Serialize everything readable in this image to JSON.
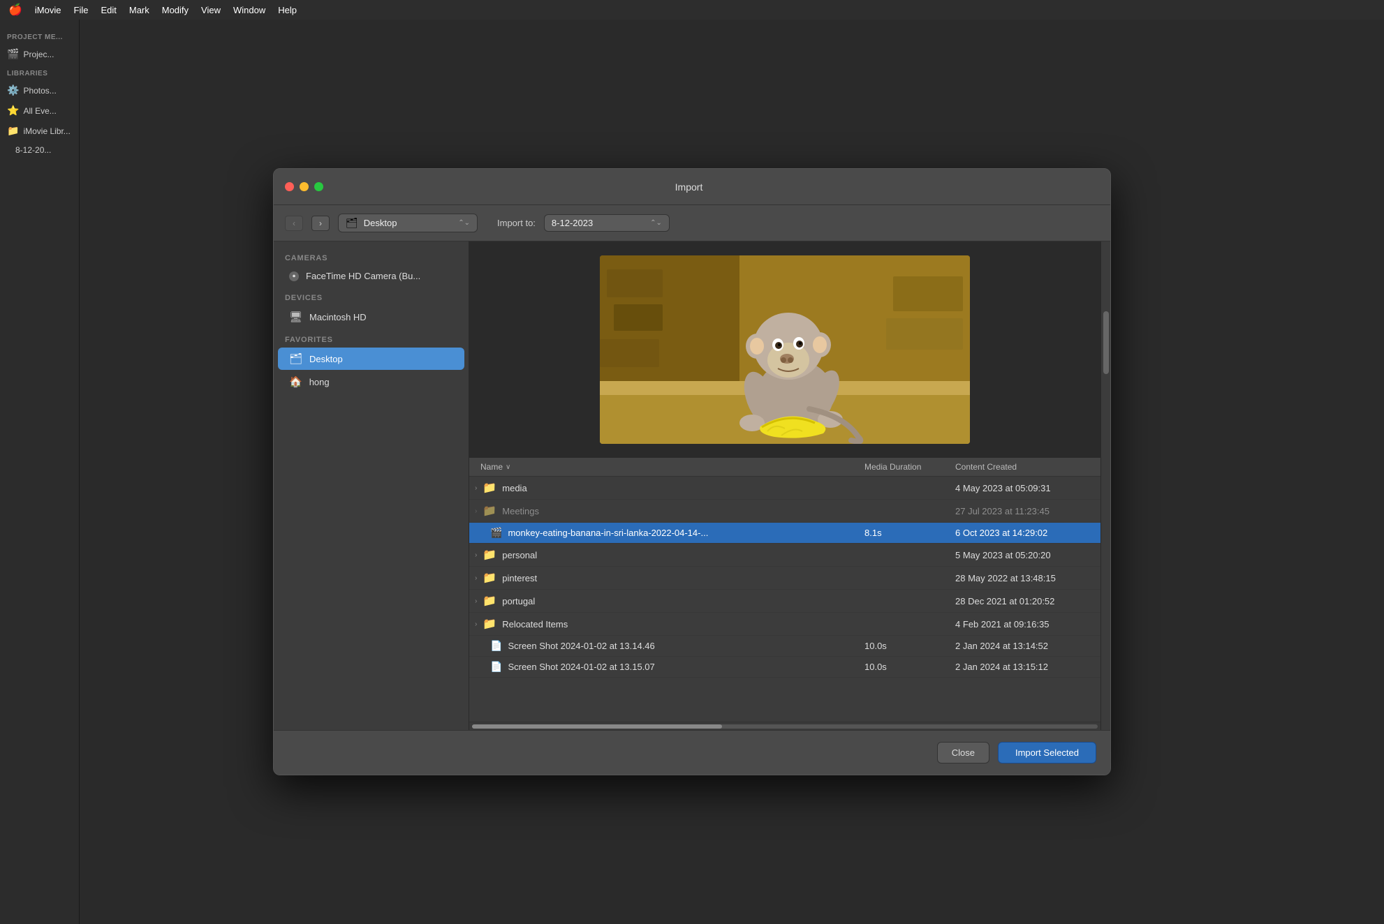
{
  "menubar": {
    "apple": "🍎",
    "items": [
      "iMovie",
      "File",
      "Edit",
      "Mark",
      "Modify",
      "View",
      "Window",
      "Help"
    ]
  },
  "window": {
    "title": "Import",
    "close_label": "×",
    "min_label": "−",
    "max_label": "+"
  },
  "toolbar": {
    "location": "Desktop",
    "location_icon": "🗂",
    "import_to_label": "Import to:",
    "import_to_value": "8-12-2023"
  },
  "sidebar": {
    "sections": [
      {
        "header": "CAMERAS",
        "items": [
          {
            "icon": "camera",
            "label": "FaceTime HD Camera (Bu..."
          }
        ]
      },
      {
        "header": "DEVICES",
        "items": [
          {
            "icon": "hd",
            "label": "Macintosh HD"
          }
        ]
      },
      {
        "header": "FAVORITES",
        "items": [
          {
            "icon": "desktop",
            "label": "Desktop",
            "active": true
          },
          {
            "icon": "home",
            "label": "hong"
          }
        ]
      }
    ]
  },
  "file_list": {
    "columns": [
      "Name",
      "Media Duration",
      "Content Created"
    ],
    "sort_column": "Name",
    "sort_direction": "asc",
    "rows": [
      {
        "type": "folder",
        "name": "media",
        "duration": "",
        "created": "4 May 2023 at 05:09:31",
        "selected": false,
        "dimmed": false
      },
      {
        "type": "folder",
        "name": "Meetings",
        "duration": "",
        "created": "27 Jul 2023 at 11:23:45",
        "selected": false,
        "dimmed": true
      },
      {
        "type": "file",
        "name": "monkey-eating-banana-in-sri-lanka-2022-04-14-...",
        "duration": "8.1s",
        "created": "6 Oct 2023 at 14:29:02",
        "selected": true,
        "dimmed": false
      },
      {
        "type": "folder",
        "name": "personal",
        "duration": "",
        "created": "5 May 2023 at 05:20:20",
        "selected": false,
        "dimmed": false
      },
      {
        "type": "folder",
        "name": "pinterest",
        "duration": "",
        "created": "28 May 2022 at 13:48:15",
        "selected": false,
        "dimmed": false
      },
      {
        "type": "folder",
        "name": "portugal",
        "duration": "",
        "created": "28 Dec 2021 at 01:20:52",
        "selected": false,
        "dimmed": false
      },
      {
        "type": "folder",
        "name": "Relocated Items",
        "duration": "",
        "created": "4 Feb 2021 at 09:16:35",
        "selected": false,
        "dimmed": false
      },
      {
        "type": "file",
        "name": "Screen Shot 2024-01-02 at 13.14.46",
        "duration": "10.0s",
        "created": "2 Jan 2024 at 13:14:52",
        "selected": false,
        "dimmed": false
      },
      {
        "type": "file",
        "name": "Screen Shot 2024-01-02 at 13.15.07",
        "duration": "10.0s",
        "created": "2 Jan 2024 at 13:15:12",
        "selected": false,
        "dimmed": false
      }
    ]
  },
  "footer": {
    "close_label": "Close",
    "import_label": "Import Selected"
  },
  "imovie_sidebar": {
    "project_section": "PROJECT ME...",
    "project_item": "Projec...",
    "libraries_section": "LIBRARIES",
    "library_items": [
      "Photos...",
      "All Eve...",
      "iMovie Libr...",
      "8-12-20..."
    ]
  }
}
